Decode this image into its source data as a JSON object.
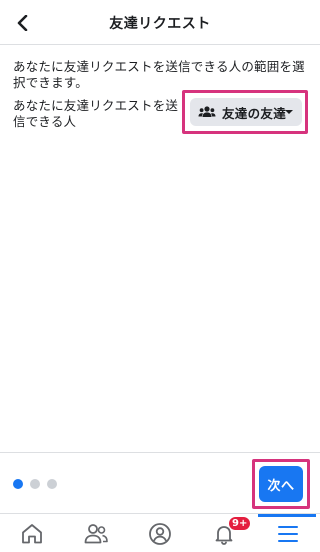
{
  "header": {
    "title": "友達リクエスト"
  },
  "main": {
    "description": "あなたに友達リクエストを送信できる人の範囲を選択できます。",
    "row_label": "あなたに友達リクエストを送信できる人",
    "audience": {
      "label": "友達の友達",
      "icon": "people-icon"
    }
  },
  "footer": {
    "pagination": {
      "total": 3,
      "current": 1
    },
    "next_label": "次へ"
  },
  "tabbar": {
    "tabs": [
      {
        "name": "home",
        "icon": "home-icon"
      },
      {
        "name": "friends",
        "icon": "friends-icon"
      },
      {
        "name": "profile",
        "icon": "profile-icon"
      },
      {
        "name": "notifications",
        "icon": "bell-icon",
        "badge": "9+"
      },
      {
        "name": "menu",
        "icon": "menu-icon",
        "active": true
      }
    ]
  },
  "colors": {
    "accent": "#1877f2",
    "highlight_outline": "#d6337d",
    "badge": "#e41e3f"
  }
}
